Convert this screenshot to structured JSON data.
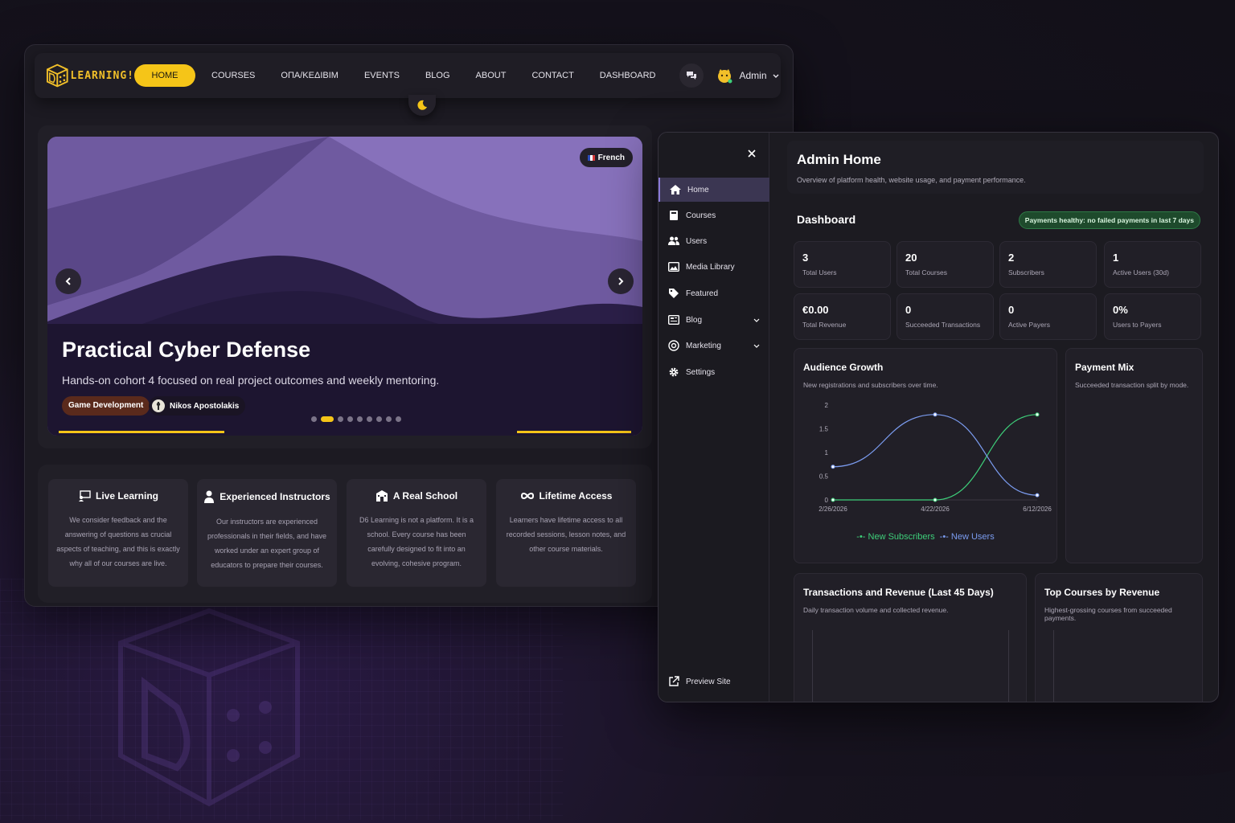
{
  "site": {
    "logo_text": "LEARNING!",
    "nav": [
      "HOME",
      "COURSES",
      "ΟΠΑ/ΚΕΔΙΒΙΜ",
      "EVENTS",
      "BLOG",
      "ABOUT",
      "CONTACT",
      "DASHBOARD"
    ],
    "user": "Admin",
    "hero": {
      "lang": "French",
      "title": "Practical Cyber Defense",
      "subtitle": "Hands-on cohort 4 focused on real project outcomes and weekly mentoring.",
      "category": "Game Development",
      "author": "Nikos Apostolakis",
      "slide_count": 9,
      "active_slide": 1
    },
    "features": [
      {
        "icon": "live-learning-icon",
        "title": "Live Learning",
        "text": "We consider feedback and the answering of questions as crucial aspects of teaching, and this is exactly why all of our courses are live."
      },
      {
        "icon": "instructor-icon",
        "title": "Experienced Instructors",
        "text": "Our instructors are experienced professionals in their fields, and have worked under an expert group of educators to prepare their courses."
      },
      {
        "icon": "school-icon",
        "title": "A Real School",
        "text": "D6 Learning is not a platform. It is a school. Every course has been carefully designed to fit into an evolving, cohesive program."
      },
      {
        "icon": "infinity-icon",
        "title": "Lifetime Access",
        "text": "Learners have lifetime access to all recorded sessions, lesson notes, and other course materials."
      }
    ]
  },
  "admin": {
    "sidebar": [
      {
        "label": "Home",
        "icon": "home-icon",
        "active": true
      },
      {
        "label": "Courses",
        "icon": "book-icon"
      },
      {
        "label": "Users",
        "icon": "users-icon"
      },
      {
        "label": "Media Library",
        "icon": "media-icon"
      },
      {
        "label": "Featured",
        "icon": "tag-icon"
      },
      {
        "label": "Blog",
        "icon": "blog-icon",
        "expandable": true
      },
      {
        "label": "Marketing",
        "icon": "target-icon",
        "expandable": true
      },
      {
        "label": "Settings",
        "icon": "gear-icon"
      }
    ],
    "preview_site": "Preview Site",
    "header": {
      "title": "Admin Home",
      "subtitle": "Overview of platform health, website usage, and payment performance."
    },
    "dashboard_title": "Dashboard",
    "health_badge": "Payments healthy: no failed payments in last 7 days",
    "stats": [
      {
        "value": "3",
        "label": "Total Users"
      },
      {
        "value": "20",
        "label": "Total Courses"
      },
      {
        "value": "2",
        "label": "Subscribers"
      },
      {
        "value": "1",
        "label": "Active Users (30d)"
      },
      {
        "value": "€0.00",
        "label": "Total Revenue"
      },
      {
        "value": "0",
        "label": "Succeeded Transactions"
      },
      {
        "value": "0",
        "label": "Active Payers"
      },
      {
        "value": "0%",
        "label": "Users to Payers"
      }
    ],
    "audience": {
      "title": "Audience Growth",
      "subtitle": "New registrations and subscribers over time."
    },
    "payment_mix": {
      "title": "Payment Mix",
      "subtitle": "Succeeded transaction split by mode."
    },
    "transactions": {
      "title": "Transactions and Revenue (Last 45 Days)",
      "subtitle": "Daily transaction volume and collected revenue."
    },
    "top_courses": {
      "title": "Top Courses by Revenue",
      "subtitle": "Highest-grossing courses from succeeded payments."
    }
  },
  "colors": {
    "accent": "#f5c518",
    "new_users": "#7b9cf0",
    "new_subscribers": "#3ecf7a"
  },
  "chart_data": {
    "type": "line",
    "x": [
      "2/26/2026",
      "4/22/2026",
      "6/12/2026"
    ],
    "x_tick_labels": [
      "2/26/2026",
      "4/22/2026",
      "6/12/2026"
    ],
    "y_ticks": [
      "0",
      "0.5",
      "1",
      "1.5",
      "2"
    ],
    "ylim": [
      0,
      2
    ],
    "series": [
      {
        "name": "New Subscribers",
        "values": [
          0,
          0,
          1.8
        ],
        "color": "#3ecf7a"
      },
      {
        "name": "New Users",
        "values": [
          0.7,
          1.8,
          0.1
        ],
        "color": "#7b9cf0"
      }
    ],
    "legend": "bottom"
  }
}
